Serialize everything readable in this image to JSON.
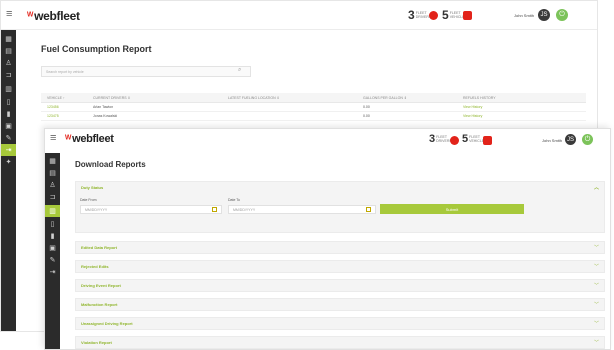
{
  "back_window": {
    "brand": "webfleet",
    "stats": [
      {
        "num": "3",
        "label": "FLEET DRIVERS"
      },
      {
        "num": "5",
        "label": "FLEET VEHICLES"
      }
    ],
    "user": "John Smith",
    "avatar_initials": "JS",
    "page_title": "Fuel Consumption Report",
    "search_placeholder": "Search report by vehicle",
    "table": {
      "headers": [
        "VEHICLE ↑",
        "CURRENT DRIVERS ⇕",
        "LATEST FUELING LOCATION ⇕",
        "GALLONS PER GALLON ⇕",
        "REFUELS HISTORY"
      ],
      "rows": [
        [
          "123456",
          "Arlan Tawton",
          "",
          "0.00",
          "View History"
        ],
        [
          "123475",
          "Jonas Kowalski",
          "",
          "0.00",
          "View History"
        ]
      ]
    },
    "sidebar_icons": [
      "dashboard-icon",
      "doc-icon",
      "driver-icon",
      "truck-icon",
      "chart-icon",
      "file-icon",
      "fuel-icon",
      "report-icon",
      "edit-icon",
      "exit-icon",
      "wrench-icon"
    ],
    "sidebar_active_index": 9
  },
  "front_window": {
    "brand": "webfleet",
    "stats": [
      {
        "num": "3",
        "label": "FLEET DRIVERS"
      },
      {
        "num": "5",
        "label": "FLEET VEHICLES"
      }
    ],
    "user": "John Smith",
    "avatar_initials": "JS",
    "page_title": "Download Reports",
    "duty_status": {
      "title": "Duty Status",
      "date_from_label": "Date From",
      "date_from_placeholder": "MM/DD/YYYY",
      "date_to_label": "Date To",
      "date_to_placeholder": "MM/DD/YYYY",
      "submit_label": "Submit"
    },
    "reports": [
      "Edited Data Report",
      "Rejected Edits",
      "Driving Event Report",
      "Malfunction Report",
      "Unassigned Driving Report",
      "Violation Report"
    ],
    "sidebar_icons": [
      "dashboard-icon",
      "doc-icon",
      "driver-icon",
      "truck-icon",
      "chart-icon",
      "file-icon",
      "fuel-icon",
      "report-icon",
      "edit-icon",
      "exit-icon"
    ],
    "sidebar_active_index": 4
  },
  "colors": {
    "accent": "#a7c93b",
    "accent_text": "#8fb52b",
    "brand_red": "#e2231a",
    "sidebar": "#2b2b2b"
  }
}
